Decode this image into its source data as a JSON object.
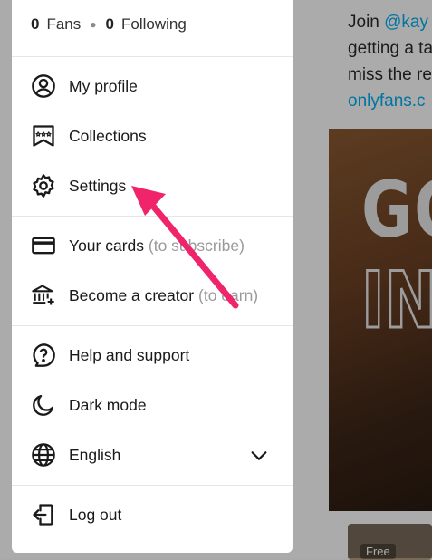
{
  "background": {
    "promo_line1_prefix": "Join ",
    "promo_line1_link": "@kay",
    "promo_line2": "getting a ta",
    "promo_line3": "miss the re",
    "promo_link": "onlyfans.c",
    "banner_line1": "GO",
    "banner_line2": "IN",
    "thumb_badge": "Free"
  },
  "menu": {
    "fans_count": "0",
    "fans_label": "Fans",
    "following_count": "0",
    "following_label": "Following",
    "items": [
      {
        "label": "My profile",
        "hint": "",
        "icon": "user-circle-icon"
      },
      {
        "label": "Collections",
        "hint": "",
        "icon": "bookmark-stars-icon"
      },
      {
        "label": "Settings",
        "hint": "",
        "icon": "gear-icon"
      },
      {
        "label": "Your cards",
        "hint": "(to subscribe)",
        "icon": "credit-card-icon"
      },
      {
        "label": "Become a creator",
        "hint": "(to earn)",
        "icon": "bank-plus-icon"
      },
      {
        "label": "Help and support",
        "hint": "",
        "icon": "help-bubble-icon"
      },
      {
        "label": "Dark mode",
        "hint": "",
        "icon": "moon-icon"
      },
      {
        "label": "English",
        "hint": "",
        "icon": "globe-icon"
      },
      {
        "label": "Log out",
        "hint": "",
        "icon": "logout-icon"
      }
    ]
  },
  "annotation": {
    "color": "#f0246b",
    "pointing_to": "Settings"
  }
}
